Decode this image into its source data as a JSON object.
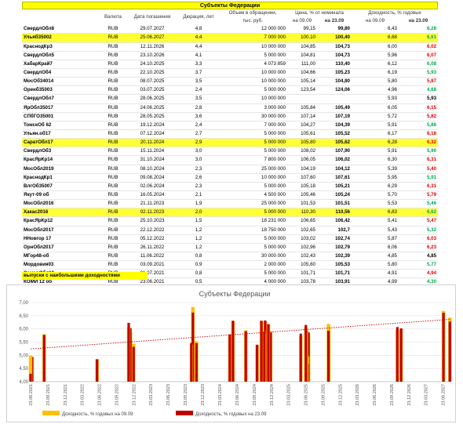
{
  "header": {
    "title": "Субъекты Федерации",
    "col_currency": "Валюта",
    "col_maturity": "Дата погашения",
    "col_duration": "Дюрация, лет",
    "col_volume_1": "Объем в обращении,",
    "col_volume_2": "тыс. руб.",
    "col_price": "Цена, % от номинала",
    "col_yield": "Доходность, % годовых",
    "date_0909": "на 09.09",
    "date_2309": "на 23.09"
  },
  "colors": {
    "highlight": "#ffff33",
    "yield_up": "#00a651",
    "yield_down": "#e00000",
    "bar_0909": "#ffc000",
    "bar_2309": "#c00000",
    "trend": "#c00000"
  },
  "rows": [
    {
      "name": "СвердлОбл8",
      "cur": "RUB",
      "date": "29.07.2027",
      "dur": "4,8",
      "vol": "12 000 000",
      "p1": "99,15",
      "p2": "99,80",
      "y1": "6,43",
      "y2": "6,28",
      "dir": "up",
      "hl": false
    },
    {
      "name": "Ульяб35002",
      "cur": "RUB",
      "date": "25.06.2027",
      "dur": "4,4",
      "vol": "7 000 000",
      "p1": "100,10",
      "p2": "100,40",
      "y1": "6,68",
      "y2": "6,61",
      "dir": "up",
      "hl": true
    },
    {
      "name": "КраснодКр3",
      "cur": "RUB",
      "date": "12.11.2026",
      "dur": "4,4",
      "vol": "10 000 000",
      "p1": "104,85",
      "p2": "104,73",
      "y1": "6,00",
      "y2": "6,02",
      "dir": "down",
      "hl": false
    },
    {
      "name": "СвердлОбл5",
      "cur": "RUB",
      "date": "23.10.2026",
      "dur": "4,1",
      "vol": "5 000 000",
      "p1": "104,81",
      "p2": "104,73",
      "y1": "5,96",
      "y2": "6,07",
      "dir": "down",
      "hl": false
    },
    {
      "name": "ХабарКрай7",
      "cur": "RUB",
      "date": "24.10.2025",
      "dur": "3,3",
      "vol": "4 073 859",
      "p1": "111,00",
      "p2": "110,40",
      "y1": "6,12",
      "y2": "6,08",
      "dir": "up",
      "hl": false
    },
    {
      "name": "СвердлОб4",
      "cur": "RUB",
      "date": "22.10.2025",
      "dur": "3,7",
      "vol": "10 000 000",
      "p1": "104,66",
      "p2": "105,23",
      "y1": "6,19",
      "y2": "5,93",
      "dir": "up",
      "hl": false
    },
    {
      "name": "МосОб34014",
      "cur": "RUB",
      "date": "08.07.2025",
      "dur": "3,5",
      "vol": "10 000 000",
      "p1": "105,14",
      "p2": "104,80",
      "y1": "5,80",
      "y2": "5,87",
      "dir": "down",
      "hl": false
    },
    {
      "name": "Оренб35003",
      "cur": "RUB",
      "date": "03.07.2025",
      "dur": "2,4",
      "vol": "5 000 000",
      "p1": "123,54",
      "p2": "124,06",
      "y1": "4,96",
      "y2": "4,68",
      "dir": "up",
      "hl": false
    },
    {
      "name": "СвердлОбл7",
      "cur": "RUB",
      "date": "28.06.2025",
      "dur": "3,5",
      "vol": "10 000 000",
      "p1": "",
      "p2": "",
      "y1": "5,93",
      "y2": "5,93",
      "dir": "same",
      "hl": false
    },
    {
      "name": "ЯрОбл35017",
      "cur": "RUB",
      "date": "24.06.2025",
      "dur": "2,8",
      "vol": "3 000 000",
      "p1": "105,84",
      "p2": "105,49",
      "y1": "6,05",
      "y2": "6,15",
      "dir": "down",
      "hl": false
    },
    {
      "name": "СПбГО35001",
      "cur": "RUB",
      "date": "28.05.2025",
      "dur": "3,6",
      "vol": "30 000 000",
      "p1": "107,14",
      "p2": "107,19",
      "y1": "5,72",
      "y2": "5,82",
      "dir": "down",
      "hl": false
    },
    {
      "name": "ТомскОб 62",
      "cur": "RUB",
      "date": "19.12.2024",
      "dur": "2,4",
      "vol": "7 000 000",
      "p1": "104,27",
      "p2": "104,39",
      "y1": "5,91",
      "y2": "5,86",
      "dir": "up",
      "hl": false
    },
    {
      "name": "Ульян.об17",
      "cur": "RUB",
      "date": "07.12.2024",
      "dur": "2,7",
      "vol": "5 000 000",
      "p1": "105,61",
      "p2": "105,52",
      "y1": "6,17",
      "y2": "6,18",
      "dir": "down",
      "hl": false
    },
    {
      "name": "СаратОбл17",
      "cur": "RUB",
      "date": "20.11.2024",
      "dur": "2,9",
      "vol": "5 000 000",
      "p1": "105,80",
      "p2": "105,62",
      "y1": "6,28",
      "y2": "6,32",
      "dir": "down",
      "hl": true
    },
    {
      "name": "СвердлОб3",
      "cur": "RUB",
      "date": "15.11.2024",
      "dur": "3,0",
      "vol": "5 000 000",
      "p1": "108,02",
      "p2": "107,90",
      "y1": "5,91",
      "y2": "5,90",
      "dir": "up",
      "hl": false
    },
    {
      "name": "КрасЯрКр14",
      "cur": "RUB",
      "date": "31.10.2024",
      "dur": "3,0",
      "vol": "7 800 000",
      "p1": "106,05",
      "p2": "106,02",
      "y1": "6,30",
      "y2": "6,31",
      "dir": "down",
      "hl": false
    },
    {
      "name": "МосОбл2019",
      "cur": "RUB",
      "date": "08.10.2024",
      "dur": "2,3",
      "vol": "25 000 000",
      "p1": "104,19",
      "p2": "104,12",
      "y1": "5,39",
      "y2": "5,40",
      "dir": "down",
      "hl": false
    },
    {
      "name": "КраснодКр1",
      "cur": "RUB",
      "date": "09.08.2024",
      "dur": "2,6",
      "vol": "10 000 000",
      "p1": "107,60",
      "p2": "107,61",
      "y1": "5,95",
      "y2": "5,91",
      "dir": "up",
      "hl": false
    },
    {
      "name": "ВлгОб35007",
      "cur": "RUB",
      "date": "02.06.2024",
      "dur": "2,3",
      "vol": "5 000 000",
      "p1": "105,18",
      "p2": "105,21",
      "y1": "6,29",
      "y2": "6,31",
      "dir": "down",
      "hl": false
    },
    {
      "name": "Якут-09 об",
      "cur": "RUB",
      "date": "16.05.2024",
      "dur": "2,1",
      "vol": "4 500 000",
      "p1": "105,46",
      "p2": "105,24",
      "y1": "5,70",
      "y2": "5,79",
      "dir": "down",
      "hl": false
    },
    {
      "name": "МосОбл2016",
      "cur": "RUB",
      "date": "21.11.2023",
      "dur": "1,9",
      "vol": "25 000 000",
      "p1": "101,53",
      "p2": "101,51",
      "y1": "5,53",
      "y2": "5,46",
      "dir": "up",
      "hl": false
    },
    {
      "name": "Хакас2016",
      "cur": "RUB",
      "date": "02.11.2023",
      "dur": "2,0",
      "vol": "5 000 000",
      "p1": "110,30",
      "p2": "110,56",
      "y1": "6,83",
      "y2": "6,62",
      "dir": "up",
      "hl": true
    },
    {
      "name": "КрасЯрКр12",
      "cur": "RUB",
      "date": "25.10.2023",
      "dur": "1,5",
      "vol": "18 231 000",
      "p1": "106,65",
      "p2": "106,42",
      "y1": "5,41",
      "y2": "5,47",
      "dir": "down",
      "hl": false
    },
    {
      "name": "МосОбл2017",
      "cur": "RUB",
      "date": "22.12.2022",
      "dur": "1,2",
      "vol": "18 750 000",
      "p1": "102,65",
      "p2": "102,7",
      "y1": "5,43",
      "y2": "5,32",
      "dir": "up",
      "hl": false
    },
    {
      "name": "ННовгор 17",
      "cur": "RUB",
      "date": "05.12.2022",
      "dur": "1,2",
      "vol": "5 000 000",
      "p1": "103,02",
      "p2": "102,74",
      "y1": "5,87",
      "y2": "6,03",
      "dir": "down",
      "hl": false
    },
    {
      "name": "ОрнОбл2017",
      "cur": "RUB",
      "date": "26.11.2022",
      "dur": "1,2",
      "vol": "5 000 000",
      "p1": "102,96",
      "p2": "102,79",
      "y1": "6,06",
      "y2": "6,23",
      "dir": "down",
      "hl": false
    },
    {
      "name": "МГор48-об",
      "cur": "RUB",
      "date": "11.06.2022",
      "dur": "0,8",
      "vol": "30 000 000",
      "p1": "102,43",
      "p2": "102,39",
      "y1": "4,85",
      "y2": "4,85",
      "dir": "same",
      "hl": false
    },
    {
      "name": "Мордовия03",
      "cur": "RUB",
      "date": "03.09.2021",
      "dur": "0,9",
      "vol": "2 000 000",
      "p1": "105,60",
      "p2": "105,53",
      "y1": "5,80",
      "y2": "5,77",
      "dir": "up",
      "hl": false
    },
    {
      "name": "СамарОбл10",
      "cur": "RUB",
      "date": "01.07.2021",
      "dur": "0,8",
      "vol": "5 000 000",
      "p1": "101,71",
      "p2": "101,71",
      "y1": "4,91",
      "y2": "4,94",
      "dir": "down",
      "hl": false
    },
    {
      "name": "КОМИ 12 об",
      "cur": "RUB",
      "date": "23.06.2021",
      "dur": "0,5",
      "vol": "4 000 000",
      "p1": "103,78",
      "p2": "103,91",
      "y1": "4,99",
      "y2": "4,30",
      "dir": "up",
      "hl": false
    }
  ],
  "note": "выпуски с наибольшими доходностями",
  "chart_data": {
    "type": "bar",
    "title": "Субъекты Федерации",
    "ylim": [
      4.0,
      7.0
    ],
    "yticks": [
      "4,00",
      "4,50",
      "5,00",
      "5,50",
      "6,00",
      "6,50",
      "7,00"
    ],
    "xticks": [
      "23.06.2021",
      "23.09.2021",
      "23.12.2021",
      "23.03.2022",
      "23.06.2022",
      "23.09.2022",
      "23.12.2022",
      "23.03.2023",
      "23.06.2023",
      "23.09.2023",
      "23.12.2023",
      "23.03.2024",
      "23.06.2024",
      "23.09.2024",
      "23.12.2024",
      "23.03.2025",
      "23.06.2025",
      "23.09.2025",
      "23.12.2025",
      "23.03.2026",
      "23.06.2026",
      "23.09.2026",
      "23.12.2026",
      "23.03.2027",
      "23.06.2027"
    ],
    "x_range": [
      "2021-06-23",
      "2027-08-01"
    ],
    "grid": true,
    "legend_position": "bottom",
    "trendline": "linear",
    "series": [
      {
        "name": "Доходность, % годовых на 09.09",
        "color": "#ffc000"
      },
      {
        "name": "Доходность, % годовых на 23.09",
        "color": "#c00000"
      }
    ],
    "points": [
      {
        "date": "2027-07-29",
        "y1": 6.43,
        "y2": 6.28
      },
      {
        "date": "2027-06-25",
        "y1": 6.68,
        "y2": 6.61
      },
      {
        "date": "2026-11-12",
        "y1": 6.0,
        "y2": 6.02
      },
      {
        "date": "2026-10-23",
        "y1": 5.96,
        "y2": 6.07
      },
      {
        "date": "2025-10-24",
        "y1": 6.12,
        "y2": 6.08
      },
      {
        "date": "2025-10-22",
        "y1": 6.19,
        "y2": 5.93
      },
      {
        "date": "2025-07-08",
        "y1": 5.8,
        "y2": 5.87
      },
      {
        "date": "2025-07-03",
        "y1": 4.96,
        "y2": 4.68
      },
      {
        "date": "2025-06-28",
        "y1": 5.93,
        "y2": 5.93
      },
      {
        "date": "2025-06-24",
        "y1": 6.05,
        "y2": 6.15
      },
      {
        "date": "2025-05-28",
        "y1": 5.72,
        "y2": 5.82
      },
      {
        "date": "2024-12-19",
        "y1": 5.91,
        "y2": 5.86
      },
      {
        "date": "2024-12-07",
        "y1": 6.17,
        "y2": 6.18
      },
      {
        "date": "2024-11-20",
        "y1": 6.28,
        "y2": 6.32
      },
      {
        "date": "2024-11-15",
        "y1": 5.91,
        "y2": 5.9
      },
      {
        "date": "2024-10-31",
        "y1": 6.3,
        "y2": 6.31
      },
      {
        "date": "2024-10-08",
        "y1": 5.39,
        "y2": 5.4
      },
      {
        "date": "2024-08-09",
        "y1": 5.95,
        "y2": 5.91
      },
      {
        "date": "2024-06-02",
        "y1": 6.29,
        "y2": 6.31
      },
      {
        "date": "2024-05-16",
        "y1": 5.7,
        "y2": 5.79
      },
      {
        "date": "2023-11-21",
        "y1": 5.53,
        "y2": 5.46
      },
      {
        "date": "2023-11-02",
        "y1": 6.83,
        "y2": 6.62
      },
      {
        "date": "2023-10-25",
        "y1": 5.41,
        "y2": 5.47
      },
      {
        "date": "2022-12-22",
        "y1": 5.43,
        "y2": 5.32
      },
      {
        "date": "2022-12-05",
        "y1": 5.87,
        "y2": 6.03
      },
      {
        "date": "2022-11-26",
        "y1": 6.06,
        "y2": 6.23
      },
      {
        "date": "2022-06-11",
        "y1": 4.85,
        "y2": 4.85
      },
      {
        "date": "2021-09-03",
        "y1": 5.8,
        "y2": 5.77
      },
      {
        "date": "2021-07-01",
        "y1": 4.91,
        "y2": 4.94
      },
      {
        "date": "2021-06-23",
        "y1": 4.99,
        "y2": 4.3
      }
    ]
  }
}
